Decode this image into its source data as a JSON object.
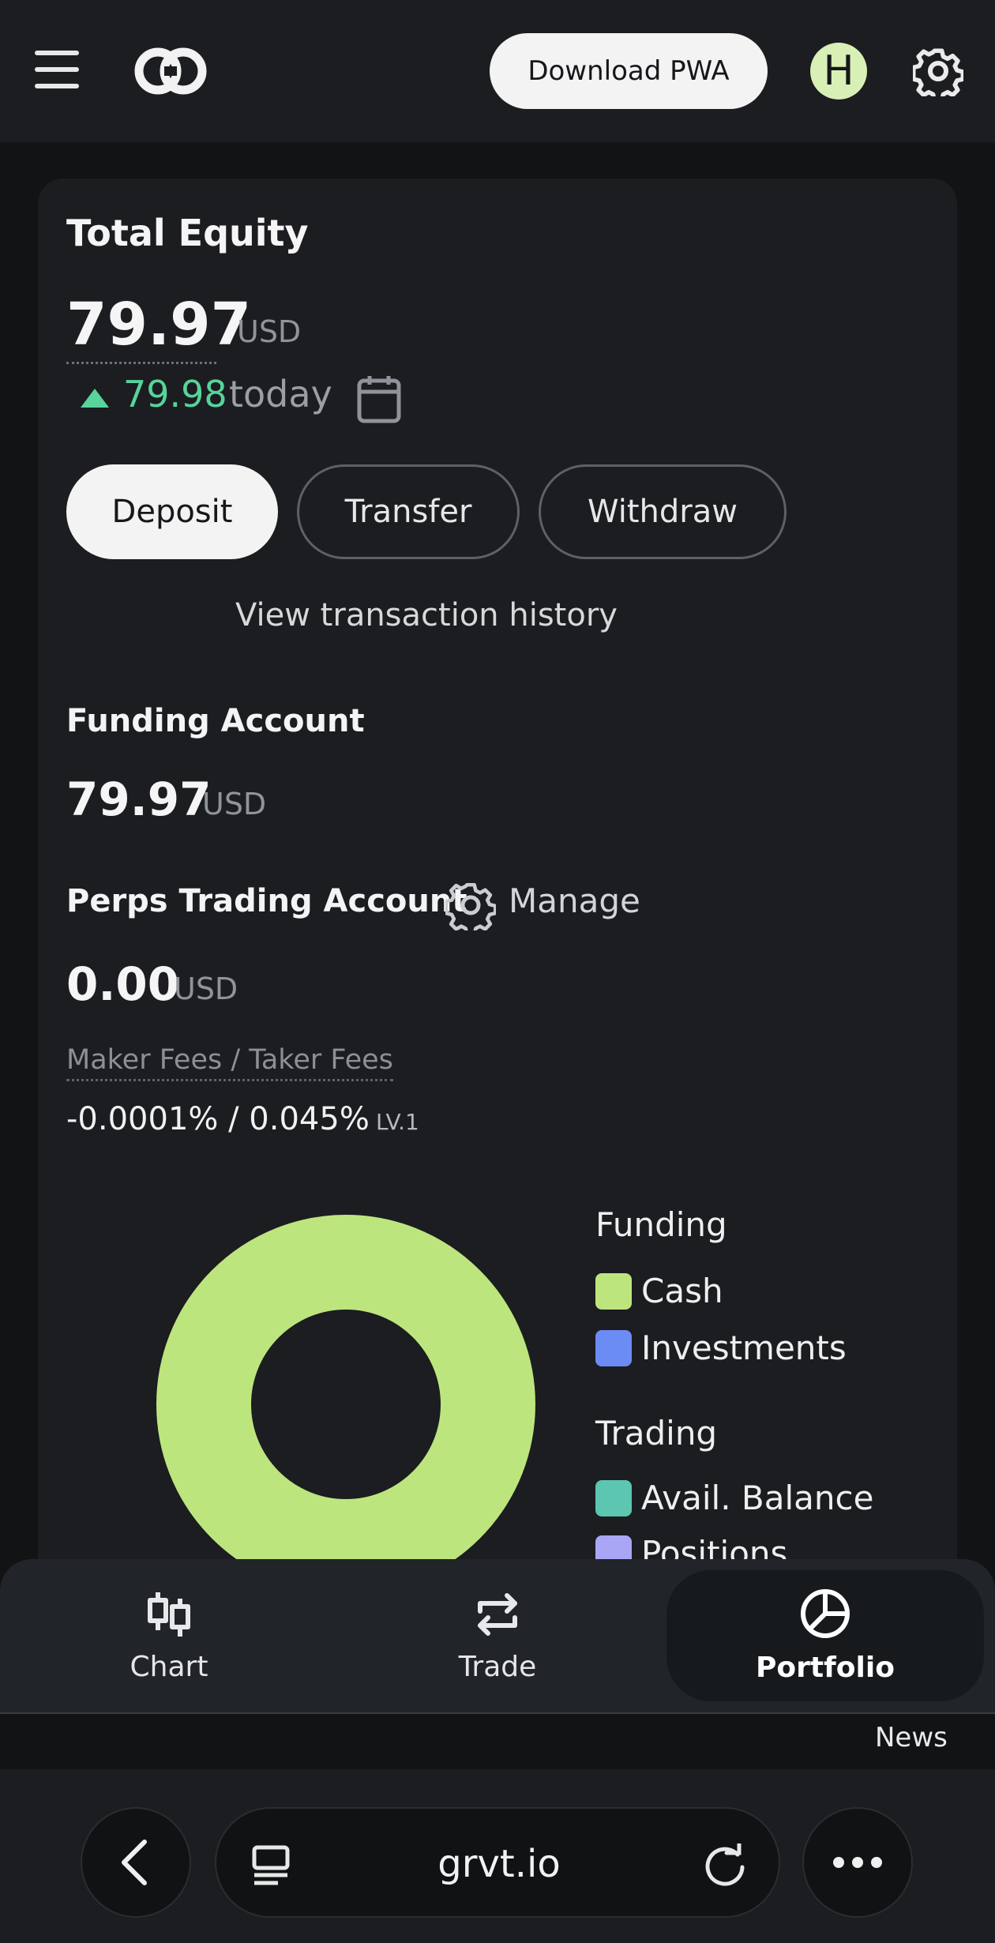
{
  "header": {
    "download_label": "Download PWA",
    "avatar_initial": "H"
  },
  "equity": {
    "title": "Total Equity",
    "value": "79.97",
    "unit": "USD",
    "change_value": "79.98",
    "change_suffix": "today"
  },
  "actions": {
    "deposit": "Deposit",
    "transfer": "Transfer",
    "withdraw": "Withdraw",
    "history": "View transaction history"
  },
  "funding": {
    "title": "Funding Account",
    "value": "79.97",
    "unit": "USD"
  },
  "perps": {
    "title": "Perps Trading Account",
    "manage": "Manage",
    "value": "0.00",
    "unit": "USD",
    "fees_label": "Maker Fees / Taker Fees",
    "fees_value": "-0.0001% / 0.045%",
    "level": "LV.1"
  },
  "allocation": {
    "funding_head": "Funding",
    "trading_head": "Trading",
    "items": [
      {
        "label": "Cash",
        "color": "#bde57e"
      },
      {
        "label": "Investments",
        "color": "#6b8bf5"
      },
      {
        "label": "Avail. Balance",
        "color": "#5cc6b0"
      },
      {
        "label": "Positions",
        "color": "#a9a6f5"
      }
    ]
  },
  "nav": {
    "chart": "Chart",
    "trade": "Trade",
    "portfolio": "Portfolio",
    "news": "News"
  },
  "browser": {
    "url": "grvt.io"
  },
  "colors": {
    "accent_green": "#58d39a",
    "cash": "#bde57e",
    "background": "#111315",
    "card": "#1b1d20"
  }
}
